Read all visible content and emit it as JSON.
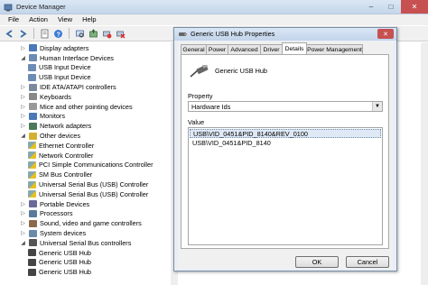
{
  "window": {
    "title": "Device Manager",
    "buttons": [
      "–",
      "□",
      "✕"
    ]
  },
  "menu": [
    "File",
    "Action",
    "View",
    "Help"
  ],
  "toolbar": {
    "icons": [
      "back-icon",
      "forward-icon",
      "properties-icon",
      "help-icon",
      "scan-icon",
      "update-driver-icon",
      "disable-icon",
      "uninstall-icon"
    ]
  },
  "tree": [
    {
      "label": "Display adapters",
      "level": 1,
      "expander": "plus",
      "icon": "display-adapter-icon",
      "color": "#4a78b8"
    },
    {
      "label": "Human Interface Devices",
      "level": 1,
      "expander": "minus",
      "icon": "hid-icon",
      "color": "#6c8cb4"
    },
    {
      "label": "USB Input Device",
      "level": 2,
      "expander": "",
      "icon": "hid-device-icon",
      "color": "#6c8cb4"
    },
    {
      "label": "USB Input Device",
      "level": 2,
      "expander": "",
      "icon": "hid-device-icon",
      "color": "#6c8cb4"
    },
    {
      "label": "IDE ATA/ATAPI controllers",
      "level": 1,
      "expander": "plus",
      "icon": "ide-controller-icon",
      "color": "#7a8a9a"
    },
    {
      "label": "Keyboards",
      "level": 1,
      "expander": "plus",
      "icon": "keyboard-icon",
      "color": "#888"
    },
    {
      "label": "Mice and other pointing devices",
      "level": 1,
      "expander": "plus",
      "icon": "mouse-icon",
      "color": "#999"
    },
    {
      "label": "Monitors",
      "level": 1,
      "expander": "plus",
      "icon": "monitor-icon",
      "color": "#4a78b8"
    },
    {
      "label": "Network adapters",
      "level": 1,
      "expander": "plus",
      "icon": "network-adapter-icon",
      "color": "#4a7a5a"
    },
    {
      "label": "Other devices",
      "level": 1,
      "expander": "minus",
      "icon": "other-devices-icon",
      "color": "#d4b030"
    },
    {
      "label": "Ethernet Controller",
      "level": 2,
      "expander": "",
      "icon": "warning-device-icon",
      "color": "#d4b030"
    },
    {
      "label": "Network Controller",
      "level": 2,
      "expander": "",
      "icon": "warning-device-icon",
      "color": "#d4b030"
    },
    {
      "label": "PCI Simple Communications Controller",
      "level": 2,
      "expander": "",
      "icon": "warning-device-icon",
      "color": "#d4b030"
    },
    {
      "label": "SM Bus Controller",
      "level": 2,
      "expander": "",
      "icon": "warning-device-icon",
      "color": "#d4b030"
    },
    {
      "label": "Universal Serial Bus (USB) Controller",
      "level": 2,
      "expander": "",
      "icon": "warning-device-icon",
      "color": "#d4b030"
    },
    {
      "label": "Universal Serial Bus (USB) Controller",
      "level": 2,
      "expander": "",
      "icon": "warning-device-icon",
      "color": "#d4b030"
    },
    {
      "label": "Portable Devices",
      "level": 1,
      "expander": "plus",
      "icon": "portable-device-icon",
      "color": "#6a6a9a"
    },
    {
      "label": "Processors",
      "level": 1,
      "expander": "plus",
      "icon": "processor-icon",
      "color": "#5a7a9a"
    },
    {
      "label": "Sound, video and game controllers",
      "level": 1,
      "expander": "plus",
      "icon": "sound-icon",
      "color": "#8a6a4a"
    },
    {
      "label": "System devices",
      "level": 1,
      "expander": "plus",
      "icon": "system-device-icon",
      "color": "#6a8aaa"
    },
    {
      "label": "Universal Serial Bus controllers",
      "level": 1,
      "expander": "minus",
      "icon": "usb-controller-icon",
      "color": "#555"
    },
    {
      "label": "Generic USB Hub",
      "level": 2,
      "expander": "",
      "icon": "usb-icon",
      "color": "#444"
    },
    {
      "label": "Generic USB Hub",
      "level": 2,
      "expander": "",
      "icon": "usb-icon",
      "color": "#444"
    },
    {
      "label": "Generic USB Hub",
      "level": 2,
      "expander": "",
      "icon": "usb-icon",
      "color": "#444"
    }
  ],
  "dialog": {
    "title": "Generic USB Hub Properties",
    "tabs": [
      "General",
      "Power",
      "Advanced",
      "Driver",
      "Details",
      "Power Management"
    ],
    "active_tab": "Details",
    "device_name": "Generic USB Hub",
    "property_label": "Property",
    "property_value": "Hardware Ids",
    "value_label": "Value",
    "values": [
      "USB\\VID_0451&PID_8140&REV_0100",
      "USB\\VID_0451&PID_8140"
    ],
    "selected_value": 0,
    "ok": "OK",
    "cancel": "Cancel"
  }
}
